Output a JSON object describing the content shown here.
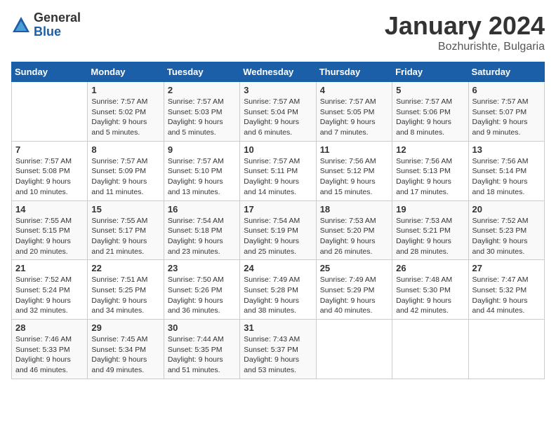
{
  "logo": {
    "general": "General",
    "blue": "Blue"
  },
  "title": {
    "month_year": "January 2024",
    "location": "Bozhurishte, Bulgaria"
  },
  "days_of_week": [
    "Sunday",
    "Monday",
    "Tuesday",
    "Wednesday",
    "Thursday",
    "Friday",
    "Saturday"
  ],
  "weeks": [
    [
      {
        "day": "",
        "info": ""
      },
      {
        "day": "1",
        "info": "Sunrise: 7:57 AM\nSunset: 5:02 PM\nDaylight: 9 hours\nand 5 minutes."
      },
      {
        "day": "2",
        "info": "Sunrise: 7:57 AM\nSunset: 5:03 PM\nDaylight: 9 hours\nand 5 minutes."
      },
      {
        "day": "3",
        "info": "Sunrise: 7:57 AM\nSunset: 5:04 PM\nDaylight: 9 hours\nand 6 minutes."
      },
      {
        "day": "4",
        "info": "Sunrise: 7:57 AM\nSunset: 5:05 PM\nDaylight: 9 hours\nand 7 minutes."
      },
      {
        "day": "5",
        "info": "Sunrise: 7:57 AM\nSunset: 5:06 PM\nDaylight: 9 hours\nand 8 minutes."
      },
      {
        "day": "6",
        "info": "Sunrise: 7:57 AM\nSunset: 5:07 PM\nDaylight: 9 hours\nand 9 minutes."
      }
    ],
    [
      {
        "day": "7",
        "info": "Sunrise: 7:57 AM\nSunset: 5:08 PM\nDaylight: 9 hours\nand 10 minutes."
      },
      {
        "day": "8",
        "info": "Sunrise: 7:57 AM\nSunset: 5:09 PM\nDaylight: 9 hours\nand 11 minutes."
      },
      {
        "day": "9",
        "info": "Sunrise: 7:57 AM\nSunset: 5:10 PM\nDaylight: 9 hours\nand 13 minutes."
      },
      {
        "day": "10",
        "info": "Sunrise: 7:57 AM\nSunset: 5:11 PM\nDaylight: 9 hours\nand 14 minutes."
      },
      {
        "day": "11",
        "info": "Sunrise: 7:56 AM\nSunset: 5:12 PM\nDaylight: 9 hours\nand 15 minutes."
      },
      {
        "day": "12",
        "info": "Sunrise: 7:56 AM\nSunset: 5:13 PM\nDaylight: 9 hours\nand 17 minutes."
      },
      {
        "day": "13",
        "info": "Sunrise: 7:56 AM\nSunset: 5:14 PM\nDaylight: 9 hours\nand 18 minutes."
      }
    ],
    [
      {
        "day": "14",
        "info": "Sunrise: 7:55 AM\nSunset: 5:15 PM\nDaylight: 9 hours\nand 20 minutes."
      },
      {
        "day": "15",
        "info": "Sunrise: 7:55 AM\nSunset: 5:17 PM\nDaylight: 9 hours\nand 21 minutes."
      },
      {
        "day": "16",
        "info": "Sunrise: 7:54 AM\nSunset: 5:18 PM\nDaylight: 9 hours\nand 23 minutes."
      },
      {
        "day": "17",
        "info": "Sunrise: 7:54 AM\nSunset: 5:19 PM\nDaylight: 9 hours\nand 25 minutes."
      },
      {
        "day": "18",
        "info": "Sunrise: 7:53 AM\nSunset: 5:20 PM\nDaylight: 9 hours\nand 26 minutes."
      },
      {
        "day": "19",
        "info": "Sunrise: 7:53 AM\nSunset: 5:21 PM\nDaylight: 9 hours\nand 28 minutes."
      },
      {
        "day": "20",
        "info": "Sunrise: 7:52 AM\nSunset: 5:23 PM\nDaylight: 9 hours\nand 30 minutes."
      }
    ],
    [
      {
        "day": "21",
        "info": "Sunrise: 7:52 AM\nSunset: 5:24 PM\nDaylight: 9 hours\nand 32 minutes."
      },
      {
        "day": "22",
        "info": "Sunrise: 7:51 AM\nSunset: 5:25 PM\nDaylight: 9 hours\nand 34 minutes."
      },
      {
        "day": "23",
        "info": "Sunrise: 7:50 AM\nSunset: 5:26 PM\nDaylight: 9 hours\nand 36 minutes."
      },
      {
        "day": "24",
        "info": "Sunrise: 7:49 AM\nSunset: 5:28 PM\nDaylight: 9 hours\nand 38 minutes."
      },
      {
        "day": "25",
        "info": "Sunrise: 7:49 AM\nSunset: 5:29 PM\nDaylight: 9 hours\nand 40 minutes."
      },
      {
        "day": "26",
        "info": "Sunrise: 7:48 AM\nSunset: 5:30 PM\nDaylight: 9 hours\nand 42 minutes."
      },
      {
        "day": "27",
        "info": "Sunrise: 7:47 AM\nSunset: 5:32 PM\nDaylight: 9 hours\nand 44 minutes."
      }
    ],
    [
      {
        "day": "28",
        "info": "Sunrise: 7:46 AM\nSunset: 5:33 PM\nDaylight: 9 hours\nand 46 minutes."
      },
      {
        "day": "29",
        "info": "Sunrise: 7:45 AM\nSunset: 5:34 PM\nDaylight: 9 hours\nand 49 minutes."
      },
      {
        "day": "30",
        "info": "Sunrise: 7:44 AM\nSunset: 5:35 PM\nDaylight: 9 hours\nand 51 minutes."
      },
      {
        "day": "31",
        "info": "Sunrise: 7:43 AM\nSunset: 5:37 PM\nDaylight: 9 hours\nand 53 minutes."
      },
      {
        "day": "",
        "info": ""
      },
      {
        "day": "",
        "info": ""
      },
      {
        "day": "",
        "info": ""
      }
    ]
  ]
}
